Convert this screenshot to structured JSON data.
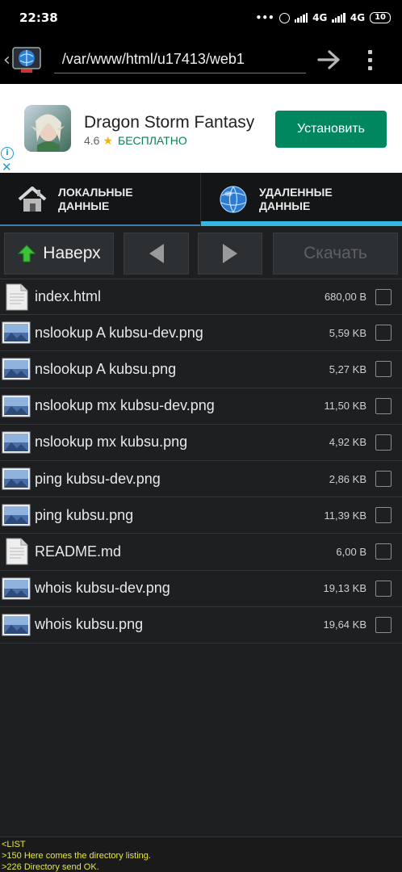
{
  "status_bar": {
    "time": "22:38",
    "dots": "•••",
    "net1": "4G",
    "net2": "4G",
    "battery": "10"
  },
  "toolbar": {
    "path": "/var/www/html/u17413/web1"
  },
  "ad": {
    "title": "Dragon Storm Fantasy",
    "rating": "4.6",
    "price": "БЕСПЛАТНО",
    "install_label": "Установить",
    "info_glyph": "i",
    "close_glyph": "✕"
  },
  "tabs": {
    "local": "ЛОКАЛЬНЫЕ\nДАННЫЕ",
    "remote": "УДАЛЕННЫЕ\nДАННЫЕ"
  },
  "nav": {
    "up_label": "Наверх",
    "download_label": "Скачать"
  },
  "files": [
    {
      "name": "index.html",
      "size": "680,00 B",
      "icon": "document-icon"
    },
    {
      "name": "nslookup A kubsu-dev.png",
      "size": "5,59 KB",
      "icon": "image-icon"
    },
    {
      "name": "nslookup A kubsu.png",
      "size": "5,27 KB",
      "icon": "image-icon"
    },
    {
      "name": "nslookup mx kubsu-dev.png",
      "size": "11,50 KB",
      "icon": "image-icon"
    },
    {
      "name": "nslookup mx kubsu.png",
      "size": "4,92 KB",
      "icon": "image-icon"
    },
    {
      "name": "ping kubsu-dev.png",
      "size": "2,86 KB",
      "icon": "image-icon"
    },
    {
      "name": "ping kubsu.png",
      "size": "11,39 KB",
      "icon": "image-icon"
    },
    {
      "name": "README.md",
      "size": "6,00 B",
      "icon": "document-icon"
    },
    {
      "name": "whois kubsu-dev.png",
      "size": "19,13 KB",
      "icon": "image-icon"
    },
    {
      "name": "whois kubsu.png",
      "size": "19,64 KB",
      "icon": "image-icon"
    }
  ],
  "log": [
    "<LIST",
    ">150 Here comes the directory listing.",
    ">226 Directory send OK."
  ]
}
